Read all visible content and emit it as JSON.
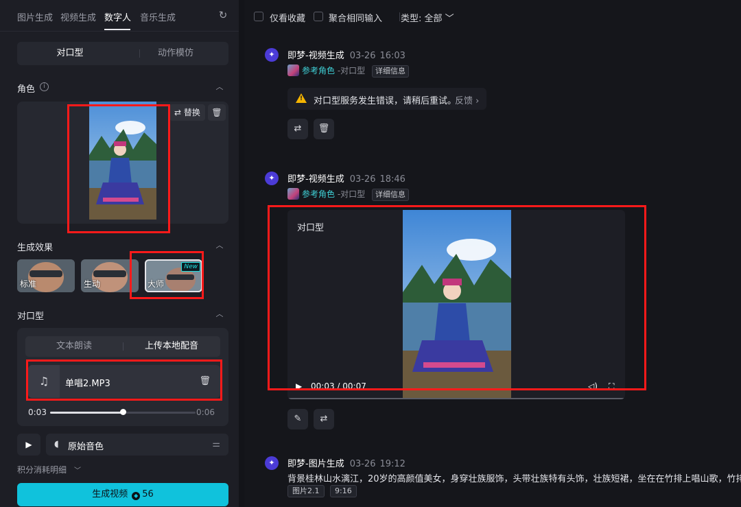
{
  "nav": {
    "tabs": [
      "图片生成",
      "视频生成",
      "数字人",
      "音乐生成"
    ],
    "active_tab": "数字人"
  },
  "mode_switch": {
    "options": [
      "对口型",
      "动作模仿"
    ],
    "selected": "对口型"
  },
  "role": {
    "title": "角色",
    "replace_label": "替换"
  },
  "effects": {
    "title": "生成效果",
    "items": [
      {
        "label": "标准"
      },
      {
        "label": "生动"
      },
      {
        "label": "大师",
        "badge": "New"
      }
    ]
  },
  "lipsync": {
    "title": "对口型",
    "tabs": [
      "文本朗读",
      "上传本地配音"
    ],
    "selected_tab": "上传本地配音",
    "file_name": "单唱2.MP3",
    "current_time": "0:03",
    "total_time": "0:06",
    "progress": 0.5,
    "voice_label": "原始音色"
  },
  "points_detail": "积分消耗明细",
  "generate": {
    "label": "生成视频",
    "cost": "56"
  },
  "filters": {
    "favorites_only": "仅看收藏",
    "aggregate_inputs": "聚合相同输入",
    "type_label": "类型: 全部"
  },
  "posts": [
    {
      "source": "即梦-视频生成",
      "date": "03-26",
      "time": "16:03",
      "ref_label": "参考角色",
      "mode": "-对口型",
      "detail": "详细信息",
      "error": "对口型服务发生错误，请稍后重试。",
      "feedback": "反馈"
    },
    {
      "source": "即梦-视频生成",
      "date": "03-26",
      "time": "18:46",
      "ref_label": "参考角色",
      "mode": "-对口型",
      "detail": "详细信息",
      "video_title": "对口型",
      "video_current": "00:03",
      "video_total": "00:07"
    },
    {
      "source": "即梦-图片生成",
      "date": "03-26",
      "time": "19:12",
      "prompt": "背景桂林山水漓江，20岁的高颜值美女，身穿壮族服饰，头带壮族特有头饰，壮族短裙，坐在在竹排上唱山歌，竹排顺水而",
      "tags": [
        "图片2.1",
        "9:16"
      ]
    }
  ],
  "colors": {
    "accent": "#10c2dc",
    "annotation": "#ff1a1a",
    "reference_link": "#3fd0d6",
    "warning": "#f5b400",
    "avatar": "#4b3bd6"
  }
}
